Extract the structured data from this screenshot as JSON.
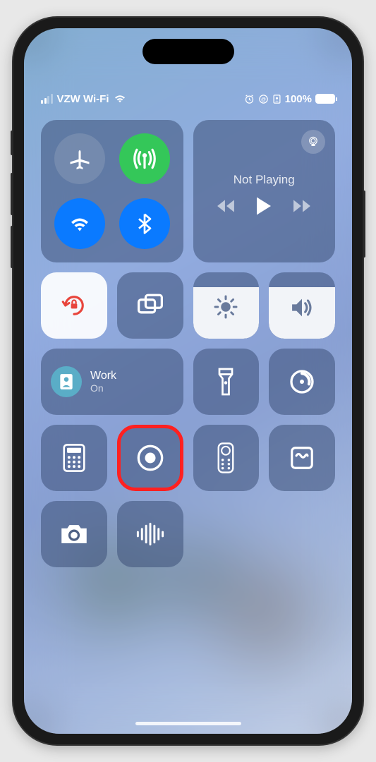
{
  "status": {
    "carrier": "VZW Wi-Fi",
    "battery_pct": "100%",
    "signal_bars": 2
  },
  "connectivity": {
    "airplane": {
      "active": false
    },
    "cellular": {
      "active": true
    },
    "wifi": {
      "active": true
    },
    "bluetooth": {
      "active": true
    }
  },
  "media": {
    "title": "Not Playing"
  },
  "focus": {
    "label": "Work",
    "status": "On"
  },
  "sliders": {
    "brightness_pct": 78,
    "volume_pct": 78
  },
  "tiles": {
    "orientation_lock": "locked",
    "screen_record_highlighted": true
  },
  "icons": {
    "airplane": "airplane",
    "cellular": "cellular-antenna",
    "wifi": "wifi",
    "bluetooth": "bluetooth",
    "airplay": "airplay",
    "rewind": "rewind",
    "play": "play",
    "forward": "forward",
    "orientation": "orientation-lock",
    "mirroring": "screen-mirroring",
    "focus_badge": "id-badge",
    "brightness": "sun",
    "volume": "speaker",
    "flashlight": "flashlight",
    "timer": "timer",
    "calculator": "calculator",
    "record": "record-circle",
    "remote": "apple-tv-remote",
    "notes": "quick-note",
    "camera": "camera",
    "voice_memo": "waveform"
  }
}
